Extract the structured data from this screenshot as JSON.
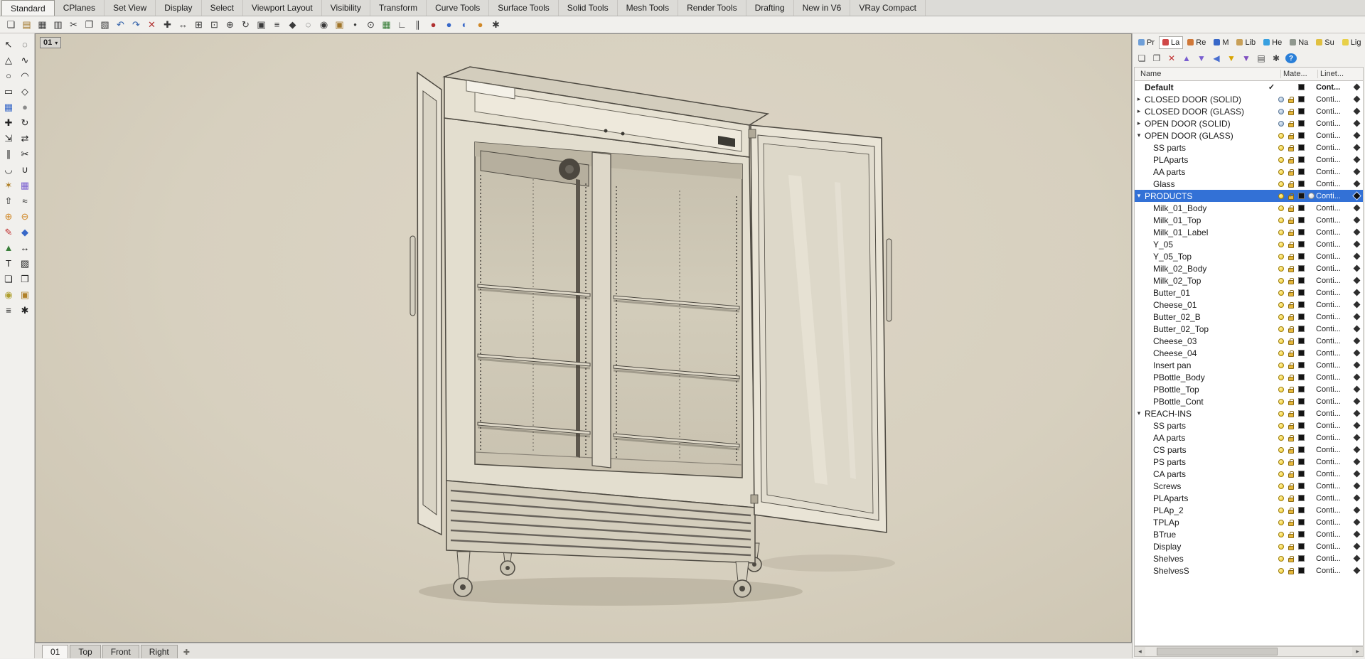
{
  "accent_color": "#3371d6",
  "menu": {
    "tabs": [
      {
        "label": "Standard",
        "active": true
      },
      {
        "label": "CPlanes"
      },
      {
        "label": "Set View"
      },
      {
        "label": "Display"
      },
      {
        "label": "Select"
      },
      {
        "label": "Viewport Layout"
      },
      {
        "label": "Visibility"
      },
      {
        "label": "Transform"
      },
      {
        "label": "Curve Tools"
      },
      {
        "label": "Surface Tools"
      },
      {
        "label": "Solid Tools"
      },
      {
        "label": "Mesh Tools"
      },
      {
        "label": "Render Tools"
      },
      {
        "label": "Drafting"
      },
      {
        "label": "New in V6"
      },
      {
        "label": "VRay Compact"
      }
    ]
  },
  "toolbar": {
    "icons": [
      {
        "name": "new-file",
        "glyph": "❏",
        "color": "#3a3a3a"
      },
      {
        "name": "open-file",
        "glyph": "▤",
        "color": "#a07428"
      },
      {
        "name": "save",
        "glyph": "▦",
        "color": "#3a3a3a"
      },
      {
        "name": "print",
        "glyph": "▥",
        "color": "#3a3a3a"
      },
      {
        "name": "cut",
        "glyph": "✂",
        "color": "#3a3a3a"
      },
      {
        "name": "copy",
        "glyph": "❐",
        "color": "#3a3a3a"
      },
      {
        "name": "paste",
        "glyph": "▧",
        "color": "#3a3a3a"
      },
      {
        "name": "undo",
        "glyph": "↶",
        "color": "#2f5fa8"
      },
      {
        "name": "redo",
        "glyph": "↷",
        "color": "#2f5fa8"
      },
      {
        "name": "delete",
        "glyph": "✕",
        "color": "#b03030"
      },
      {
        "name": "move",
        "glyph": "✚",
        "color": "#3a3a3a"
      },
      {
        "name": "pan",
        "glyph": "↔",
        "color": "#3a3a3a"
      },
      {
        "name": "zoom-extents",
        "glyph": "⊞",
        "color": "#3a3a3a"
      },
      {
        "name": "zoom-window",
        "glyph": "⊡",
        "color": "#3a3a3a"
      },
      {
        "name": "zoom",
        "glyph": "⊕",
        "color": "#3a3a3a"
      },
      {
        "name": "rotate-view",
        "glyph": "↻",
        "color": "#3a3a3a"
      },
      {
        "name": "named-views",
        "glyph": "▣",
        "color": "#3a3a3a"
      },
      {
        "name": "layers",
        "glyph": "≡",
        "color": "#3a3a3a"
      },
      {
        "name": "object-properties",
        "glyph": "◆",
        "color": "#3a3a3a"
      },
      {
        "name": "hide-objects",
        "glyph": "◌",
        "color": "#3a3a3a"
      },
      {
        "name": "show-objects",
        "glyph": "◉",
        "color": "#3a3a3a"
      },
      {
        "name": "lock-objects",
        "glyph": "▣",
        "color": "#a07428"
      },
      {
        "name": "points-on",
        "glyph": "•",
        "color": "#3a3a3a"
      },
      {
        "name": "osnap",
        "glyph": "⊙",
        "color": "#3a3a3a"
      },
      {
        "name": "grid-snap",
        "glyph": "▦",
        "color": "#3a7f3a"
      },
      {
        "name": "ortho",
        "glyph": "∟",
        "color": "#3a3a3a"
      },
      {
        "name": "planar",
        "glyph": "∥",
        "color": "#3a3a3a"
      },
      {
        "name": "record-history",
        "glyph": "●",
        "color": "#b03030"
      },
      {
        "name": "render",
        "glyph": "●",
        "color": "#3868c8"
      },
      {
        "name": "render-preview",
        "glyph": "◐",
        "color": "#3868c8"
      },
      {
        "name": "vray-render",
        "glyph": "●",
        "color": "#d08828"
      },
      {
        "name": "vray-options",
        "glyph": "✱",
        "color": "#3a3a3a"
      }
    ]
  },
  "left_toolbar": {
    "icons": [
      {
        "name": "select-arrow",
        "glyph": "↖",
        "color": "#222222"
      },
      {
        "name": "lasso-select",
        "glyph": "◌",
        "color": "#222222"
      },
      {
        "name": "polyline",
        "glyph": "△",
        "color": "#222222"
      },
      {
        "name": "control-point-curve",
        "glyph": "∿",
        "color": "#222222"
      },
      {
        "name": "circle",
        "glyph": "○",
        "color": "#222222"
      },
      {
        "name": "arc",
        "glyph": "◠",
        "color": "#222222"
      },
      {
        "name": "rectangle",
        "glyph": "▭",
        "color": "#222222"
      },
      {
        "name": "polygon",
        "glyph": "◇",
        "color": "#222222"
      },
      {
        "name": "surface-tools",
        "glyph": "▦",
        "color": "#3868c8"
      },
      {
        "name": "sphere",
        "glyph": "●",
        "color": "#8a8a8a"
      },
      {
        "name": "move",
        "glyph": "✚",
        "color": "#222222"
      },
      {
        "name": "rotate",
        "glyph": "↻",
        "color": "#222222"
      },
      {
        "name": "scale",
        "glyph": "⇲",
        "color": "#222222"
      },
      {
        "name": "mirror",
        "glyph": "⇄",
        "color": "#222222"
      },
      {
        "name": "offset",
        "glyph": "∥",
        "color": "#222222"
      },
      {
        "name": "trim",
        "glyph": "✂",
        "color": "#222222"
      },
      {
        "name": "fillet",
        "glyph": "◡",
        "color": "#222222"
      },
      {
        "name": "join",
        "glyph": "∪",
        "color": "#222222"
      },
      {
        "name": "explode",
        "glyph": "✶",
        "color": "#b08028"
      },
      {
        "name": "array",
        "glyph": "▦",
        "color": "#7a5fd0"
      },
      {
        "name": "extrude",
        "glyph": "⇧",
        "color": "#222222"
      },
      {
        "name": "loft",
        "glyph": "≈",
        "color": "#222222"
      },
      {
        "name": "boolean-union",
        "glyph": "⊕",
        "color": "#d08828"
      },
      {
        "name": "boolean-difference",
        "glyph": "⊖",
        "color": "#d08828"
      },
      {
        "name": "curve-tools",
        "glyph": "✎",
        "color": "#c03030"
      },
      {
        "name": "surface-from-curves",
        "glyph": "◆",
        "color": "#3868c8"
      },
      {
        "name": "mesh-tools",
        "glyph": "▲",
        "color": "#3a7f3a"
      },
      {
        "name": "dimension",
        "glyph": "↔",
        "color": "#222222"
      },
      {
        "name": "text",
        "glyph": "T",
        "color": "#222222"
      },
      {
        "name": "hatch",
        "glyph": "▨",
        "color": "#222222"
      },
      {
        "name": "block",
        "glyph": "❏",
        "color": "#222222"
      },
      {
        "name": "group",
        "glyph": "❐",
        "color": "#222222"
      },
      {
        "name": "visibility",
        "glyph": "◉",
        "color": "#b0a030"
      },
      {
        "name": "lock",
        "glyph": "▣",
        "color": "#b08028"
      },
      {
        "name": "layer-state",
        "glyph": "≡",
        "color": "#222222"
      },
      {
        "name": "options",
        "glyph": "✱",
        "color": "#222222"
      }
    ]
  },
  "viewport": {
    "label": "01",
    "caret": "▾",
    "tabs": [
      {
        "label": "01",
        "active": true
      },
      {
        "label": "Top"
      },
      {
        "label": "Front"
      },
      {
        "label": "Right"
      }
    ],
    "new_tab_icon": "✚"
  },
  "right_panel": {
    "tabs": [
      {
        "name": "properties",
        "label": "Pr",
        "color": "#6f9fd8"
      },
      {
        "name": "layers",
        "label": "La",
        "color": "#d04848",
        "active": true
      },
      {
        "name": "rendering",
        "label": "Re",
        "color": "#d07838"
      },
      {
        "name": "materials",
        "label": "M",
        "color": "#3868c8"
      },
      {
        "name": "libraries",
        "label": "Lib",
        "color": "#c8a058"
      },
      {
        "name": "help",
        "label": "He",
        "color": "#38a0e0"
      },
      {
        "name": "named-views",
        "label": "Na",
        "color": "#90988f"
      },
      {
        "name": "sun",
        "label": "Su",
        "color": "#e0c040"
      },
      {
        "name": "lights",
        "label": "Lig",
        "color": "#e8d048"
      }
    ],
    "toolbar": [
      {
        "name": "new-layer",
        "glyph": "❏",
        "color": "#4a4a4a"
      },
      {
        "name": "new-sublayer",
        "glyph": "❐",
        "color": "#4a4a4a"
      },
      {
        "name": "delete-layer",
        "glyph": "✕",
        "color": "#c03030"
      },
      {
        "name": "move-layer-up",
        "glyph": "▲",
        "color": "#7a5fd0"
      },
      {
        "name": "move-layer-down",
        "glyph": "▼",
        "color": "#7a5fd0"
      },
      {
        "name": "collapse-all",
        "glyph": "◀",
        "color": "#4a6fd0"
      },
      {
        "name": "filter-layers",
        "glyph": "▼",
        "color": "#d8a400"
      },
      {
        "name": "filter-objects",
        "glyph": "▼",
        "color": "#8050c0"
      },
      {
        "name": "layer-list",
        "glyph": "▤",
        "color": "#4a4a4a"
      },
      {
        "name": "layer-tools",
        "glyph": "✱",
        "color": "#4a4a4a"
      },
      {
        "name": "help",
        "glyph": "?",
        "color": "#ffffff",
        "bg": "#2a7fd8"
      }
    ],
    "columns": {
      "name": "Name",
      "material": "Mate...",
      "linetype": "Linet..."
    },
    "hscroll": {
      "left": "◂",
      "right": "▸"
    },
    "row_defaults": {
      "level": 0,
      "arrow": "",
      "bulb": "on",
      "lock": true,
      "swatch": true,
      "mat": false,
      "check": false,
      "bold": false,
      "selected": false,
      "linetype": "Conti...",
      "lt_bold": false
    },
    "layers": [
      {
        "name": "Default",
        "level": 0,
        "check": true,
        "bold": true,
        "bulb": "",
        "lock": false,
        "linetype": "Cont...",
        "lt_bold": true
      },
      {
        "name": "CLOSED DOOR (SOLID)",
        "arrow": "col",
        "bulb": "off"
      },
      {
        "name": "CLOSED DOOR (GLASS)",
        "arrow": "col",
        "bulb": "off"
      },
      {
        "name": "OPEN DOOR (SOLID)",
        "arrow": "col",
        "bulb": "off"
      },
      {
        "name": "OPEN DOOR (GLASS)",
        "arrow": "exp"
      },
      {
        "name": "SS parts",
        "level": 1
      },
      {
        "name": "PLAparts",
        "level": 1
      },
      {
        "name": "AA parts",
        "level": 1
      },
      {
        "name": "Glass",
        "level": 1
      },
      {
        "name": "PRODUCTS",
        "arrow": "exp",
        "selected": true,
        "mat": true
      },
      {
        "name": "Milk_01_Body",
        "level": 1
      },
      {
        "name": "Milk_01_Top",
        "level": 1
      },
      {
        "name": "Milk_01_Label",
        "level": 1
      },
      {
        "name": "Y_05",
        "level": 1
      },
      {
        "name": "Y_05_Top",
        "level": 1
      },
      {
        "name": "Milk_02_Body",
        "level": 1
      },
      {
        "name": "Milk_02_Top",
        "level": 1
      },
      {
        "name": "Butter_01",
        "level": 1
      },
      {
        "name": "Cheese_01",
        "level": 1
      },
      {
        "name": "Butter_02_B",
        "level": 1
      },
      {
        "name": "Butter_02_Top",
        "level": 1
      },
      {
        "name": "Cheese_03",
        "level": 1
      },
      {
        "name": "Cheese_04",
        "level": 1
      },
      {
        "name": "Insert pan",
        "level": 1
      },
      {
        "name": "PBottle_Body",
        "level": 1
      },
      {
        "name": "PBottle_Top",
        "level": 1
      },
      {
        "name": "PBottle_Cont",
        "level": 1
      },
      {
        "name": "REACH-INS",
        "arrow": "exp"
      },
      {
        "name": "SS parts",
        "level": 1
      },
      {
        "name": "AA parts",
        "level": 1
      },
      {
        "name": "CS parts",
        "level": 1
      },
      {
        "name": "PS parts",
        "level": 1
      },
      {
        "name": "CA parts",
        "level": 1
      },
      {
        "name": "Screws",
        "level": 1
      },
      {
        "name": "PLAparts",
        "level": 1
      },
      {
        "name": "PLAp_2",
        "level": 1
      },
      {
        "name": "TPLAp",
        "level": 1
      },
      {
        "name": "BTrue",
        "level": 1
      },
      {
        "name": "Display",
        "level": 1
      },
      {
        "name": "Shelves",
        "level": 1
      },
      {
        "name": "ShelvesS",
        "level": 1
      }
    ]
  }
}
